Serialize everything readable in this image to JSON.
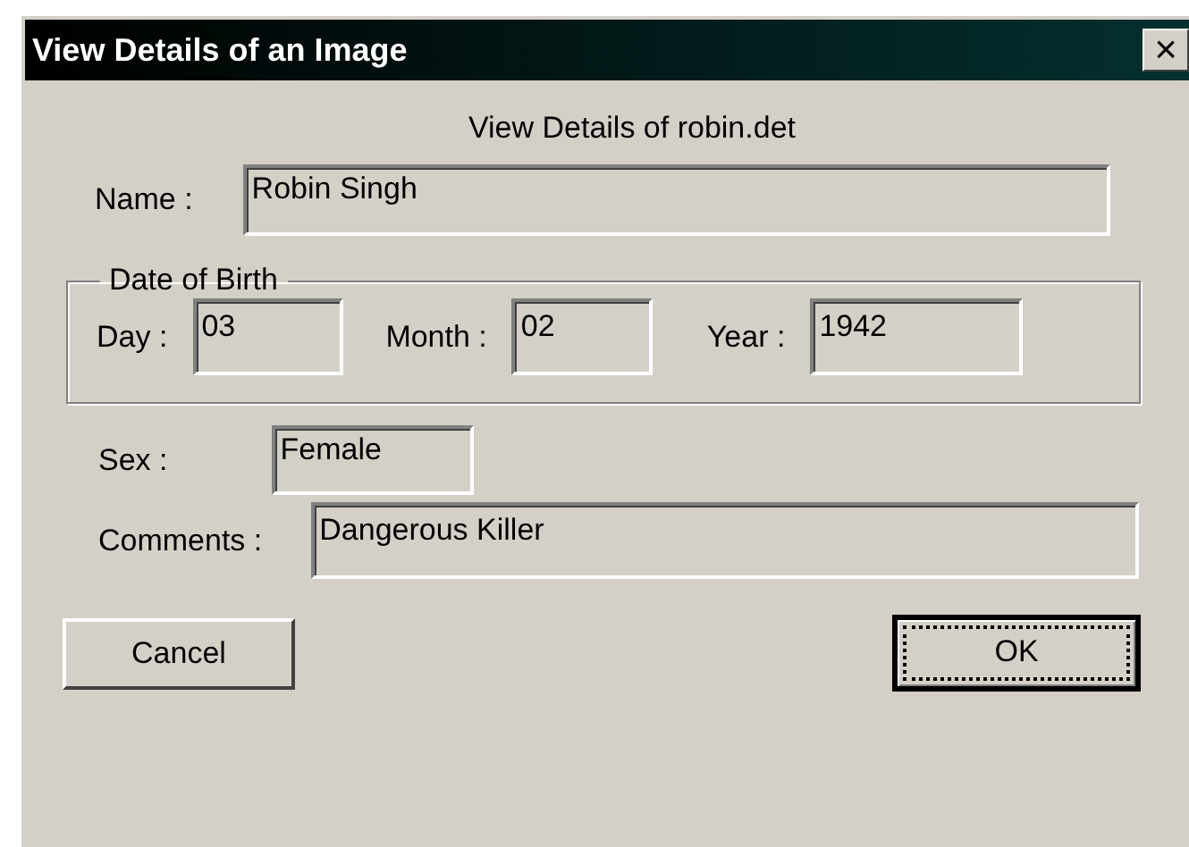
{
  "window": {
    "title": "View Details of an Image",
    "close": "×"
  },
  "heading": "View Details of robin.det",
  "name": {
    "label": "Name :",
    "value": "Robin Singh"
  },
  "date_of_birth": {
    "legend": "Date of Birth",
    "fields": [
      {
        "label": "Day :",
        "value": "03"
      },
      {
        "label": "Month :",
        "value": "02"
      },
      {
        "label": "Year :",
        "value": "1942"
      }
    ]
  },
  "sex": {
    "label": "Sex :",
    "value": "Female"
  },
  "comments": {
    "label": "Comments :",
    "value": "Dangerous Killer"
  },
  "buttons": [
    {
      "label": "Cancel",
      "focused": false
    },
    {
      "label": "OK",
      "focused": true
    }
  ]
}
